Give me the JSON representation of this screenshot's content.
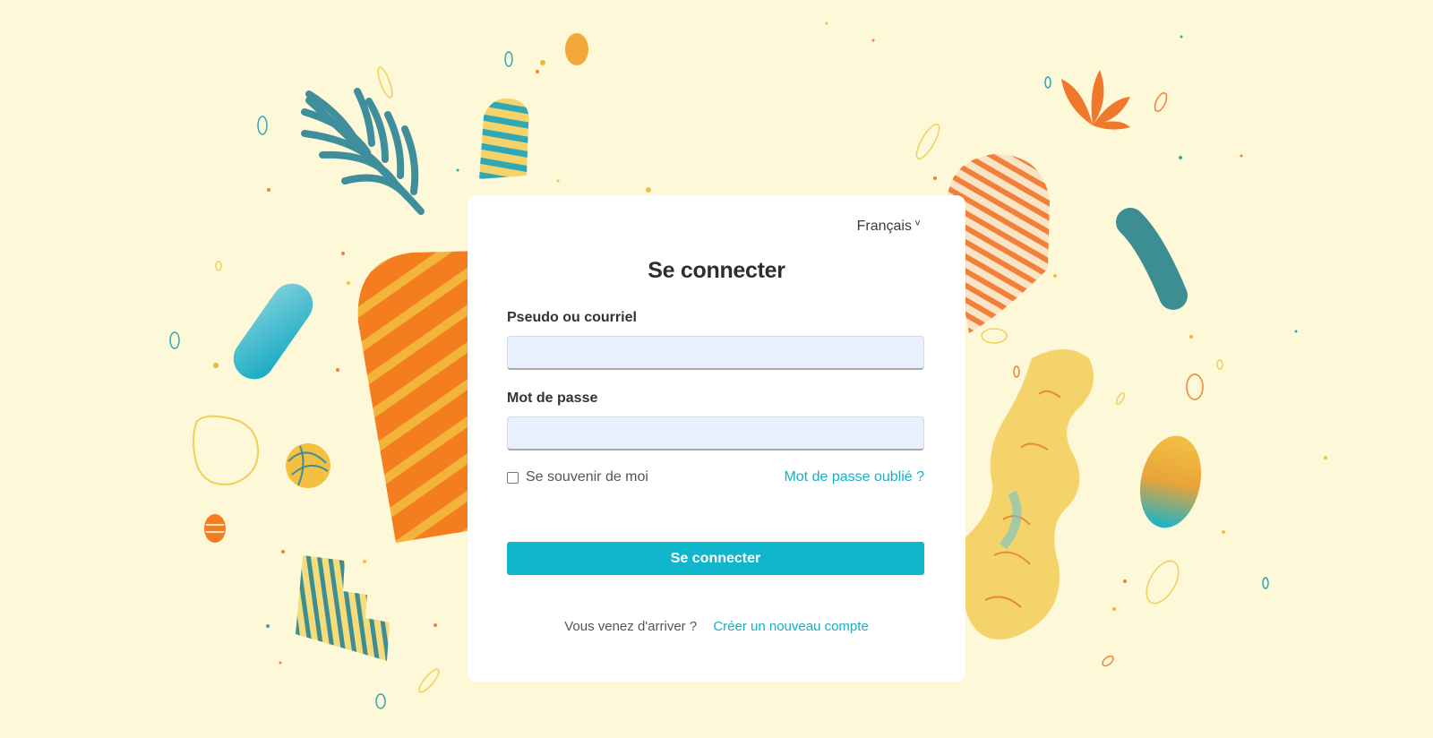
{
  "language": {
    "label": "Français",
    "chevron": "˅"
  },
  "login": {
    "title": "Se connecter",
    "username_label": "Pseudo ou courriel",
    "username_value": "",
    "password_label": "Mot de passe",
    "password_value": "",
    "remember_label": "Se souvenir de moi",
    "forgot_label": "Mot de passe oublié ?",
    "submit_label": "Se connecter"
  },
  "footer": {
    "question": "Vous venez d'arriver ?",
    "register_label": "Créer un nouveau compte"
  },
  "colors": {
    "background": "#fdf9d8",
    "accent": "#10b7cc",
    "orange": "#f47d20",
    "yellow": "#f3c042",
    "teal": "#3b8f99"
  }
}
